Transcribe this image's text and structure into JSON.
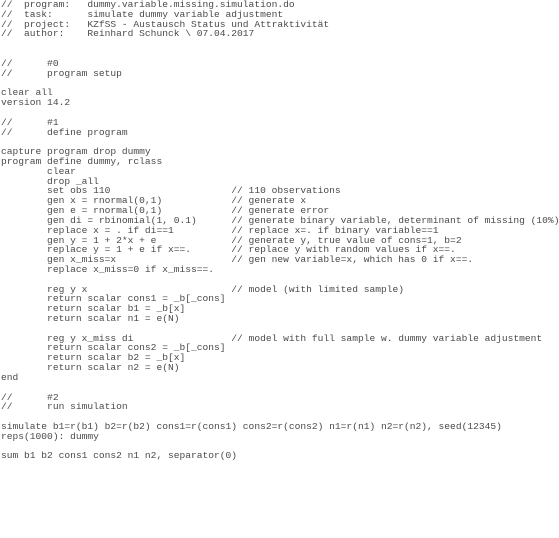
{
  "document": {
    "type": "stata-do-file",
    "lines": [
      "//  program:   dummy.variable.missing.simulation.do",
      "//  task:      simulate dummy variable adjustment",
      "//  project:   KZfSS - Austausch Status und Attraktivität",
      "//  author:    Reinhard Schunck \\ 07.04.2017",
      "",
      "",
      "//      #0",
      "//      program setup",
      "",
      "clear all",
      "version 14.2",
      "",
      "//      #1",
      "//      define program",
      "",
      "capture program drop dummy",
      "program define dummy, rclass",
      "        clear",
      "        drop _all",
      "        set obs 110                     // 110 observations",
      "        gen x = rnormal(0,1)            // generate x",
      "        gen e = rnormal(0,1)            // generate error",
      "        gen di = rbinomial(1, 0.1)      // generate binary variable, determinant of missing (10%)",
      "        replace x = . if di==1          // replace x=. if binary variable==1",
      "        gen y = 1 + 2*x + e             // generate y, true value of cons=1, b=2",
      "        replace y = 1 + e if x==.       // replace y with random values if x==.",
      "        gen x_miss=x                    // gen new variable=x, which has 0 if x==.",
      "        replace x_miss=0 if x_miss==.",
      "",
      "        reg y x                         // model (with limited sample)",
      "        return scalar cons1 = _b[_cons]",
      "        return scalar b1 = _b[x]",
      "        return scalar n1 = e(N)",
      "",
      "        reg y x_miss di                 // model with full sample w. dummy variable adjustment",
      "        return scalar cons2 = _b[_cons]",
      "        return scalar b2 = _b[x]",
      "        return scalar n2 = e(N)",
      "end",
      "",
      "//      #2",
      "//      run simulation",
      "",
      "simulate b1=r(b1) b2=r(b2) cons1=r(cons1) cons2=r(cons2) n1=r(n1) n2=r(n2), seed(12345)",
      "reps(1000): dummy",
      "",
      "sum b1 b2 cons1 cons2 n1 n2, separator(0)"
    ]
  }
}
